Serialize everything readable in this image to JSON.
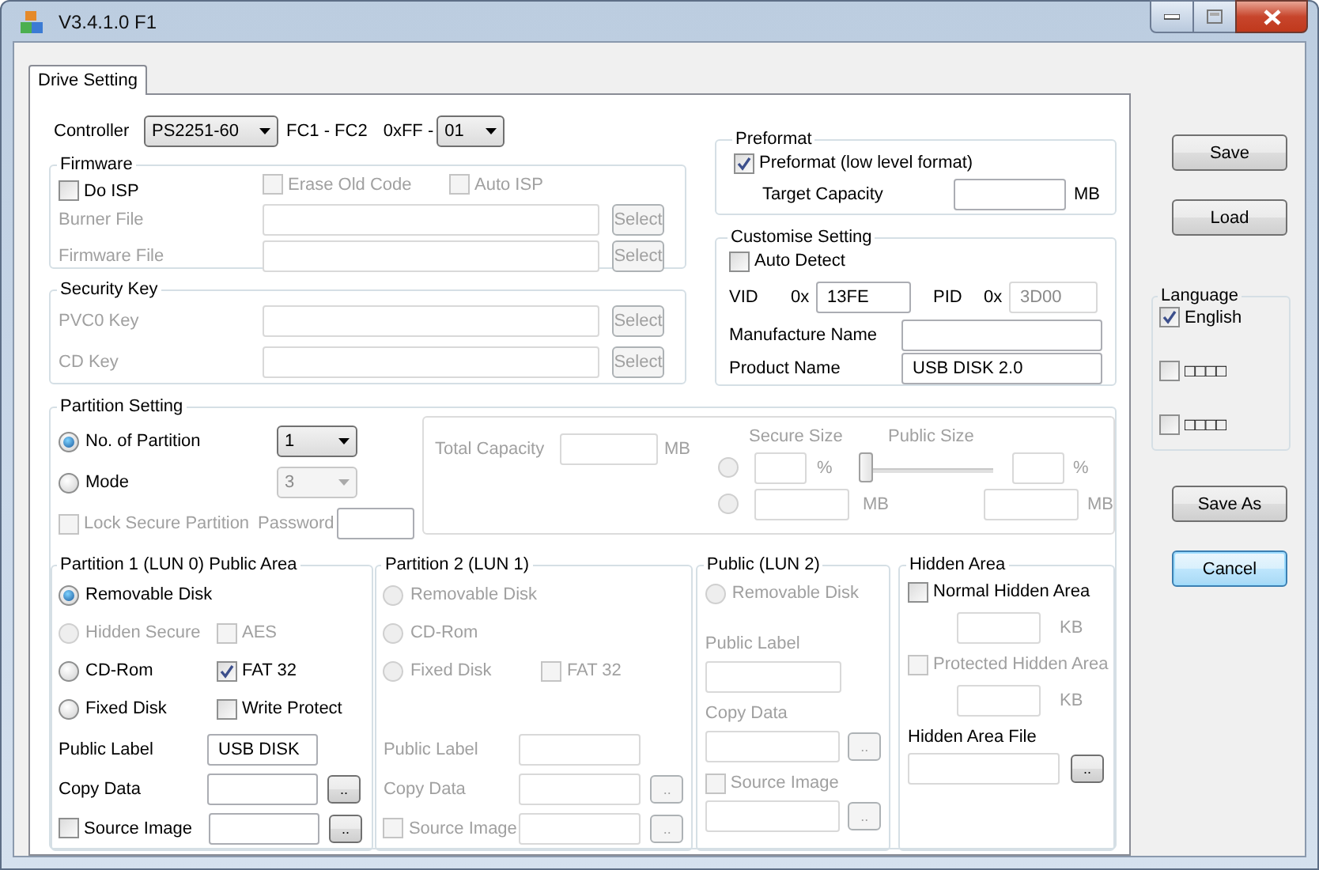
{
  "window": {
    "title": "V3.4.1.0 F1"
  },
  "tabs": [
    {
      "label": "Drive Setting",
      "selected": true
    }
  ],
  "controller": {
    "label": "Controller",
    "value": "PS2251-60",
    "range": "FC1 - FC2",
    "ff_label": "0xFF -",
    "ff_value": "01"
  },
  "firmware": {
    "title": "Firmware",
    "options": [
      {
        "label": "Do ISP",
        "checked": false,
        "disabled": false
      },
      {
        "label": "Erase Old Code",
        "checked": false,
        "disabled": true
      },
      {
        "label": "Auto ISP",
        "checked": false,
        "disabled": true
      }
    ],
    "files": [
      {
        "label": "Burner File",
        "button": "Select",
        "disabled": true
      },
      {
        "label": "Firmware File",
        "button": "Select",
        "disabled": true
      }
    ]
  },
  "security_key": {
    "title": "Security Key",
    "keys": [
      {
        "label": "PVC0 Key",
        "button": "Select",
        "disabled": true
      },
      {
        "label": "CD Key",
        "button": "Select",
        "disabled": true
      }
    ]
  },
  "preformat": {
    "title": "Preformat",
    "option": {
      "label": "Preformat (low level format)",
      "checked": true
    },
    "target_capacity": {
      "label": "Target Capacity",
      "unit": "MB"
    }
  },
  "customise_setting": {
    "title": "Customise Setting",
    "auto_detect": {
      "label": "Auto Detect",
      "checked": false
    },
    "ids": [
      {
        "label": "VID",
        "prefix": "0x",
        "value": "13FE",
        "disabled": false
      },
      {
        "label": "PID",
        "prefix": "0x",
        "value": "3D00",
        "disabled": true
      }
    ],
    "names": [
      {
        "label": "Manufacture Name"
      },
      {
        "label": "Product Name",
        "value": "USB DISK 2.0"
      }
    ]
  },
  "partition_setting": {
    "title": "Partition Setting",
    "modes": [
      {
        "label": "No. of Partition",
        "selected": true,
        "value": "1"
      },
      {
        "label": "Mode",
        "selected": false,
        "value": "3"
      }
    ],
    "lock": {
      "label": "Lock Secure Partition",
      "checked": false,
      "disabled": true
    },
    "password": {
      "label": "Password"
    },
    "capacity": {
      "disabled": true,
      "total_label": "Total Capacity",
      "total_unit": "MB",
      "secure_label": "Secure Size",
      "public_label": "Public Size",
      "slider": {
        "level": 0
      },
      "rows": [
        {
          "selected": false,
          "secure_unit": "%",
          "public_unit": "%"
        },
        {
          "selected": false,
          "secure_unit": "MB",
          "public_unit": "MB"
        }
      ]
    }
  },
  "partitions": [
    {
      "kind": "inline",
      "title": "Partition 1 (LUN 0) Public Area",
      "disabled": false,
      "types": [
        {
          "label": "Removable Disk",
          "selected": true,
          "disabled": false
        },
        {
          "label": "Hidden Secure",
          "selected": false,
          "disabled": true,
          "option": {
            "label": "AES",
            "checked": false,
            "disabled": true
          }
        },
        {
          "label": "CD-Rom",
          "selected": false,
          "disabled": false,
          "option": {
            "label": "FAT 32",
            "checked": true,
            "disabled": false
          }
        },
        {
          "label": "Fixed Disk",
          "selected": false,
          "disabled": false,
          "option": {
            "label": "Write Protect",
            "checked": false,
            "disabled": false
          }
        }
      ],
      "public_label": {
        "label": "Public Label",
        "value": "USB DISK"
      },
      "copy_data": {
        "label": "Copy Data",
        "button": ".."
      },
      "source_image": {
        "label": "Source Image",
        "checked": false,
        "button": ".."
      }
    },
    {
      "kind": "inline",
      "title": "Partition 2 (LUN 1)",
      "disabled": true,
      "types": [
        {
          "label": "Removable Disk",
          "selected": false,
          "disabled": true
        },
        {
          "label": "CD-Rom",
          "selected": false,
          "disabled": true
        },
        {
          "label": "Fixed Disk",
          "selected": false,
          "disabled": true,
          "option": {
            "label": "FAT 32",
            "checked": false,
            "disabled": true
          }
        }
      ],
      "public_label": {
        "label": "Public Label"
      },
      "copy_data": {
        "label": "Copy Data",
        "button": ".."
      },
      "source_image": {
        "label": "Source Image",
        "checked": false,
        "button": ".."
      }
    },
    {
      "kind": "stacked",
      "title": "Public (LUN 2)",
      "disabled": true,
      "types": [
        {
          "label": "Removable Disk",
          "selected": false,
          "disabled": true
        }
      ],
      "public_label": {
        "label": "Public Label"
      },
      "copy_data": {
        "label": "Copy Data",
        "button": ".."
      },
      "source_image": {
        "label": "Source Image",
        "checked": false,
        "button": ".."
      }
    }
  ],
  "hidden_area": {
    "title": "Hidden Area",
    "areas": [
      {
        "label": "Normal Hidden Area",
        "checked": false,
        "disabled": false,
        "unit": "KB"
      },
      {
        "label": "Protected Hidden Area",
        "checked": false,
        "disabled": true,
        "unit": "KB"
      }
    ],
    "file": {
      "label": "Hidden Area File",
      "button": ".."
    }
  },
  "buttons": [
    {
      "label": "Save",
      "focused": false
    },
    {
      "label": "Load",
      "focused": false
    },
    {
      "label": "Save As",
      "focused": false
    },
    {
      "label": "Cancel",
      "focused": true
    }
  ],
  "language": {
    "title": "Language",
    "options": [
      {
        "label": "English",
        "checked": true
      },
      {
        "label": "□□□□",
        "checked": false
      },
      {
        "label": "□□□□",
        "checked": false
      }
    ]
  }
}
